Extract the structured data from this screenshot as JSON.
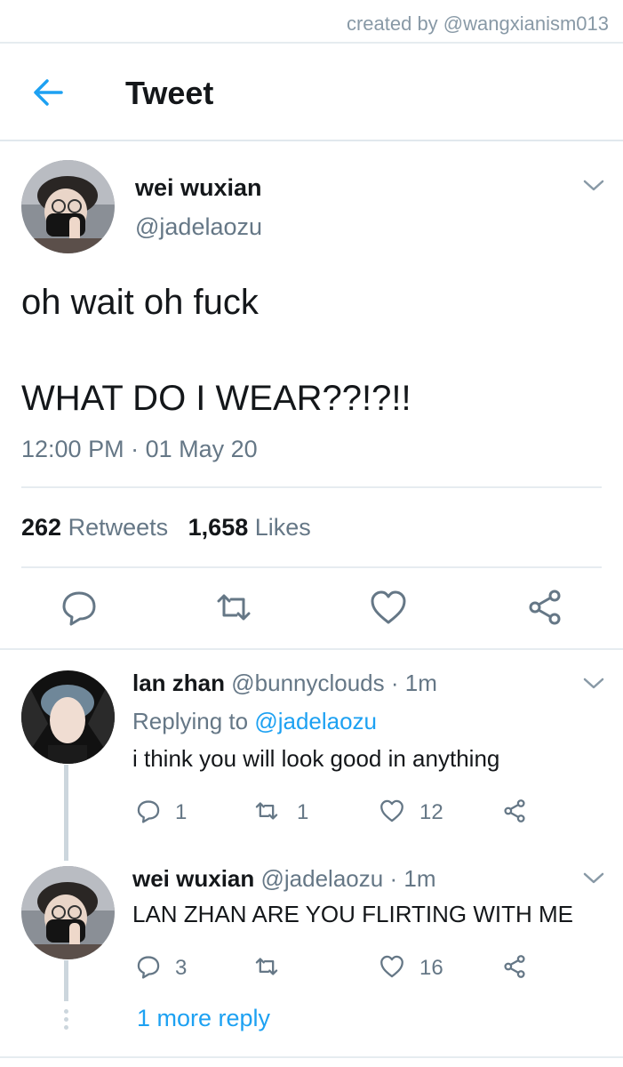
{
  "watermark": "created by @wangxianism013",
  "header": {
    "title": "Tweet"
  },
  "main_tweet": {
    "name": "wei wuxian",
    "handle": "@jadelaozu",
    "text_line1": "oh wait oh fuck",
    "text_line2": "WHAT DO I WEAR??!?!!",
    "time": "12:00 PM",
    "date_sep": "·",
    "date": "01 May 20",
    "retweets_count": "262",
    "retweets_label": "Retweets",
    "likes_count": "1,658",
    "likes_label": "Likes"
  },
  "replies": [
    {
      "name": "lan zhan",
      "handle": "@bunnyclouds",
      "sep": "·",
      "time": "1m",
      "replying_prefix": "Replying to",
      "replying_handle": "@jadelaozu",
      "text": "i think you will look good in anything",
      "reply_count": "1",
      "retweet_count": "1",
      "like_count": "12"
    },
    {
      "name": "wei wuxian",
      "handle": "@jadelaozu",
      "sep": "·",
      "time": "1m",
      "text": "LAN ZHAN ARE YOU FLIRTING WITH ME",
      "reply_count": "3",
      "retweet_count": "",
      "like_count": "16"
    }
  ],
  "more_replies": "1 more reply",
  "colors": {
    "accent": "#1da1f2",
    "secondary_text": "#657786",
    "divider": "#e6ecf0",
    "thread_line": "#ccd6dd"
  },
  "icons": [
    "back-arrow-icon",
    "chevron-down-icon",
    "reply-icon",
    "retweet-icon",
    "like-icon",
    "share-icon"
  ]
}
